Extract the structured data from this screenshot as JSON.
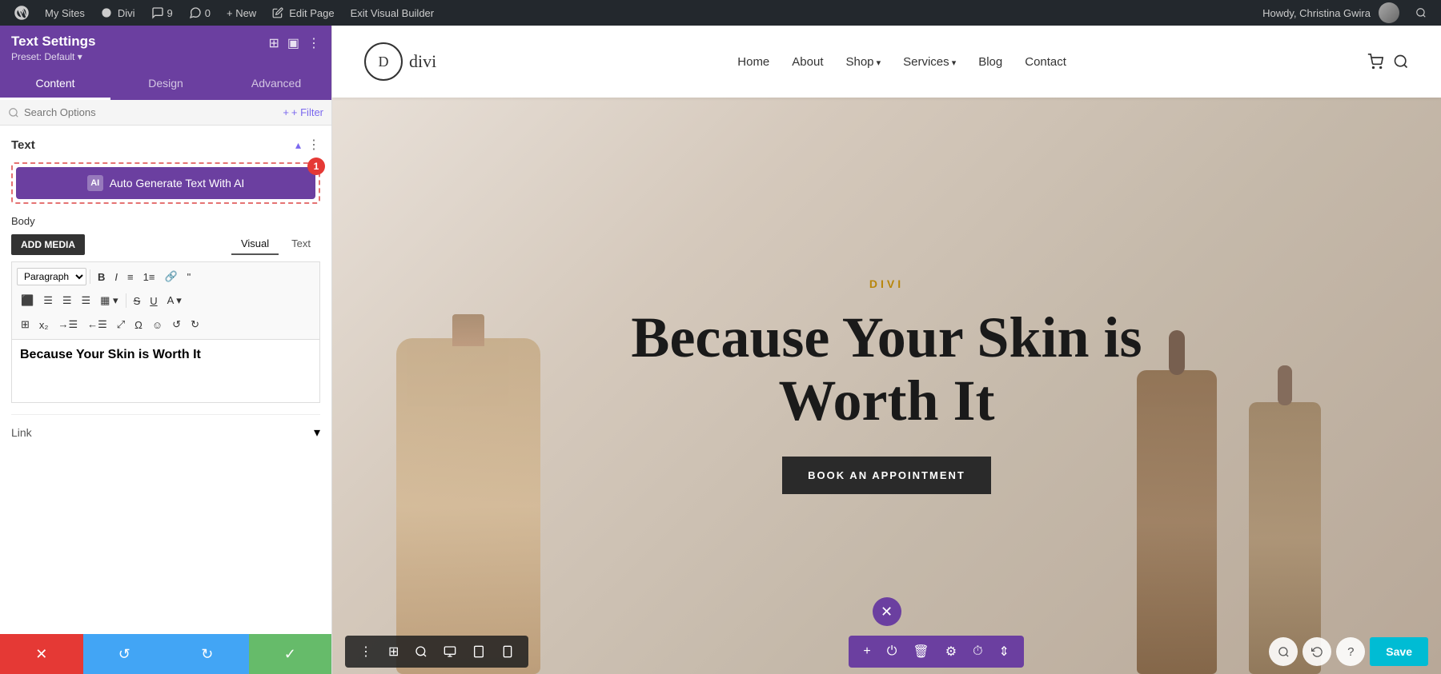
{
  "admin_bar": {
    "wp_label": "WordPress",
    "my_sites": "My Sites",
    "divi": "Divi",
    "comments_count": "9",
    "messages_count": "0",
    "new_label": "+ New",
    "edit_page": "Edit Page",
    "exit_builder": "Exit Visual Builder",
    "howdy": "Howdy, Christina Gwira"
  },
  "panel": {
    "title": "Text Settings",
    "preset": "Preset: Default ▾",
    "tabs": [
      "Content",
      "Design",
      "Advanced"
    ],
    "active_tab": "Content",
    "search_placeholder": "Search Options",
    "filter_label": "+ Filter",
    "section_title": "Text",
    "ai_button_label": "Auto Generate Text With AI",
    "ai_badge": "1",
    "body_label": "Body",
    "add_media": "ADD MEDIA",
    "visual_tab": "Visual",
    "text_tab": "Text",
    "paragraph_option": "Paragraph",
    "editor_content": "Because Your Skin is Worth It",
    "link_label": "Link",
    "bottom_buttons": {
      "cancel": "✕",
      "reset": "↺",
      "redo": "↻",
      "confirm": "✓"
    }
  },
  "site": {
    "logo_text": "divi",
    "logo_letter": "D",
    "nav_items": [
      "Home",
      "About",
      "Shop",
      "Services",
      "Blog",
      "Contact"
    ],
    "has_dropdown": [
      "Shop",
      "Services"
    ],
    "brand": "DIVI",
    "hero_title": "Because Your Skin is Worth It",
    "cta_label": "BOOK AN APPOINTMENT"
  },
  "builder": {
    "save_label": "Save"
  }
}
